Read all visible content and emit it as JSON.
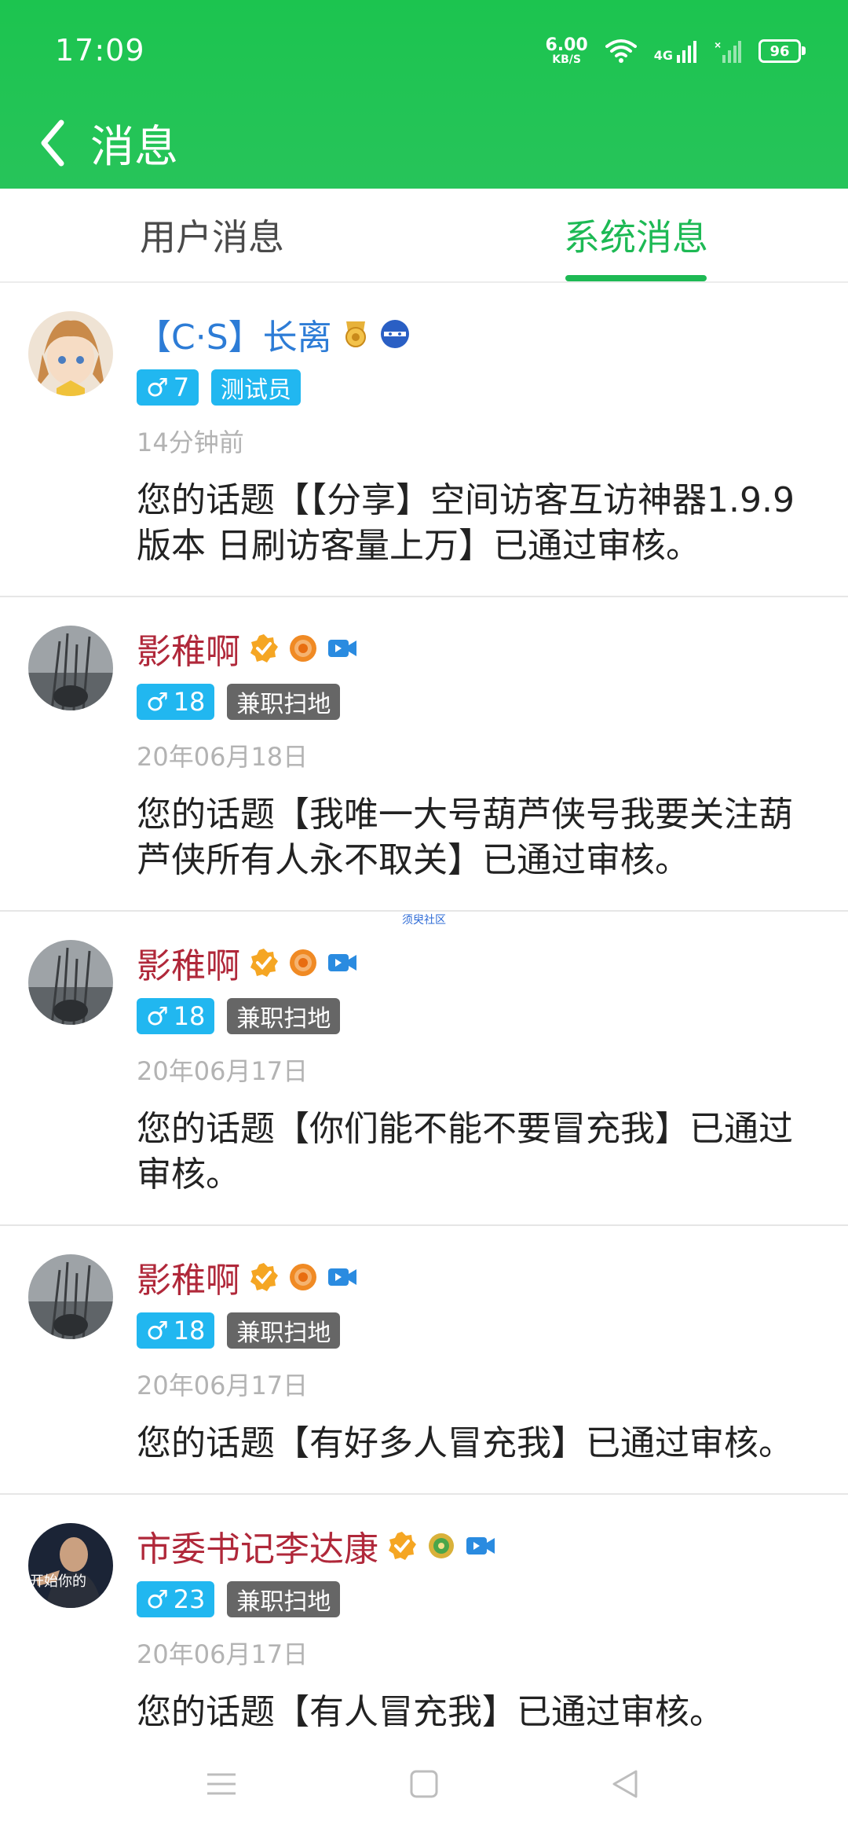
{
  "status_bar": {
    "time": "17:09",
    "net_speed_value": "6.00",
    "net_speed_unit": "KB/S",
    "network_label": "4G",
    "battery": "96"
  },
  "header": {
    "title": "消息",
    "back_icon": "chevron-left-icon"
  },
  "tabs": [
    {
      "label": "用户消息",
      "active": false
    },
    {
      "label": "系统消息",
      "active": true
    }
  ],
  "messages": [
    {
      "name": "【C·S】长离",
      "name_color": "#2d7cd6",
      "gender": "♂",
      "level": "7",
      "role": "测试员",
      "role_color": "#21b7f0",
      "time": "14分钟前",
      "text": "您的话题【【分享】空间访客互访神器1.9.9版本 日刷访客量上万】已通过审核。"
    },
    {
      "name": "影稚啊",
      "name_color": "#b0283a",
      "gender": "♂",
      "level": "18",
      "role": "兼职扫地",
      "role_color": "#666666",
      "time": "20年06月18日",
      "text": "您的话题【我唯一大号葫芦侠号我要关注葫芦侠所有人永不取关】已通过审核。"
    },
    {
      "name": "影稚啊",
      "name_color": "#b0283a",
      "gender": "♂",
      "level": "18",
      "role": "兼职扫地",
      "role_color": "#666666",
      "time": "20年06月17日",
      "text": "您的话题【你们能不能不要冒充我】已通过审核。"
    },
    {
      "name": "影稚啊",
      "name_color": "#b0283a",
      "gender": "♂",
      "level": "18",
      "role": "兼职扫地",
      "role_color": "#666666",
      "time": "20年06月17日",
      "text": "您的话题【有好多人冒充我】已通过审核。"
    },
    {
      "name": "市委书记李达康",
      "name_color": "#b0283a",
      "gender": "♂",
      "level": "23",
      "role": "兼职扫地",
      "role_color": "#666666",
      "time": "20年06月17日",
      "text": "您的话题【有人冒充我】已通过审核。",
      "avatar_caption": "开始你的"
    }
  ],
  "watermark": "须臾社区",
  "bottom_nav": [
    "menu-icon",
    "home-icon",
    "back-triangle-icon"
  ]
}
